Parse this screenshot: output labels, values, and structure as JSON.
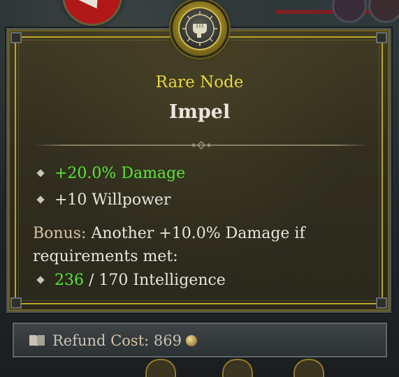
{
  "tooltip": {
    "rarity": "Rare Node",
    "name": "Impel",
    "stats": [
      {
        "text": "+20.0% Damage",
        "color": "#59e53a"
      },
      {
        "text": "+10 Willpower",
        "color": "#e7e5df"
      }
    ],
    "bonus": {
      "label": "Bonus:",
      "text": " Another +10.0% Damage if requirements met:",
      "requirement_current": "236",
      "requirement_rest": " / 170 Intelligence"
    },
    "icon": "fist-icon"
  },
  "footer": {
    "refund_label": "Refund",
    "cost_label": "Cost:",
    "cost_value": "869",
    "icon": "book-icon",
    "currency_icon": "gold-coin-icon"
  },
  "colors": {
    "rarity": "#e4d63a",
    "positive": "#59e53a",
    "panel_border": "#b9a62a"
  }
}
